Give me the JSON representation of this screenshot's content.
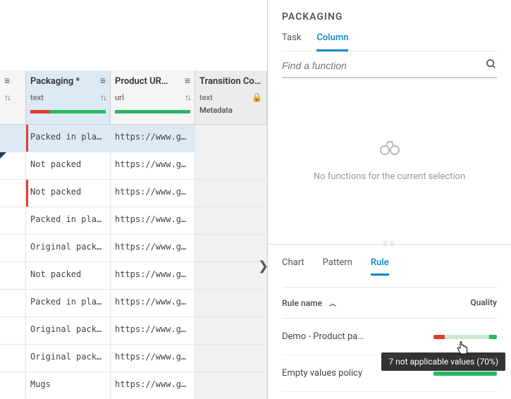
{
  "columns": [
    {
      "title": "",
      "type": ""
    },
    {
      "title": "Packaging *",
      "type": "text",
      "quality_red_pct": 25
    },
    {
      "title": "Product UR…",
      "type": "url",
      "quality_red_pct": 0
    },
    {
      "title": "Transition Co…",
      "type": "text",
      "meta": "Metadata",
      "locked": true
    }
  ],
  "rows": [
    {
      "packaging": "Packed in plast…",
      "url": "https://www.goo…",
      "selected": true,
      "red": true
    },
    {
      "packaging": "Not packed",
      "url": "https://www.go…",
      "fold": true
    },
    {
      "packaging": "Not packed",
      "url": "https://www.go…",
      "red": true
    },
    {
      "packaging": "Packed in plast…",
      "url": "https://www.go…"
    },
    {
      "packaging": "Original packag…",
      "url": "https://www.go…"
    },
    {
      "packaging": "Not packed",
      "url": "https://www.go…"
    },
    {
      "packaging": "Packed in plast…",
      "url": "https://www.go…"
    },
    {
      "packaging": "Original packag…",
      "url": "https://www.go…"
    },
    {
      "packaging": "Original packag…",
      "url": "https://www.go…"
    },
    {
      "packaging": "Mugs",
      "url": "https://www.go…"
    }
  ],
  "panel_title": "PACKAGING",
  "top_tabs": {
    "task": "Task",
    "column": "Column"
  },
  "search_placeholder": "Find a function",
  "empty_message": "No functions for the current selection",
  "level2_tabs": {
    "chart": "Chart",
    "pattern": "Pattern",
    "rule": "Rule"
  },
  "rule_header": {
    "name": "Rule name",
    "quality": "Quality"
  },
  "rules": [
    {
      "name": "Demo - Product pa…",
      "red_pct": 18,
      "light_pct": 70,
      "green_pct": 12
    },
    {
      "name": "Empty values policy",
      "red_pct": 0,
      "light_pct": 0,
      "green_pct": 100
    }
  ],
  "tooltip": "7 not applicable values (70%)"
}
